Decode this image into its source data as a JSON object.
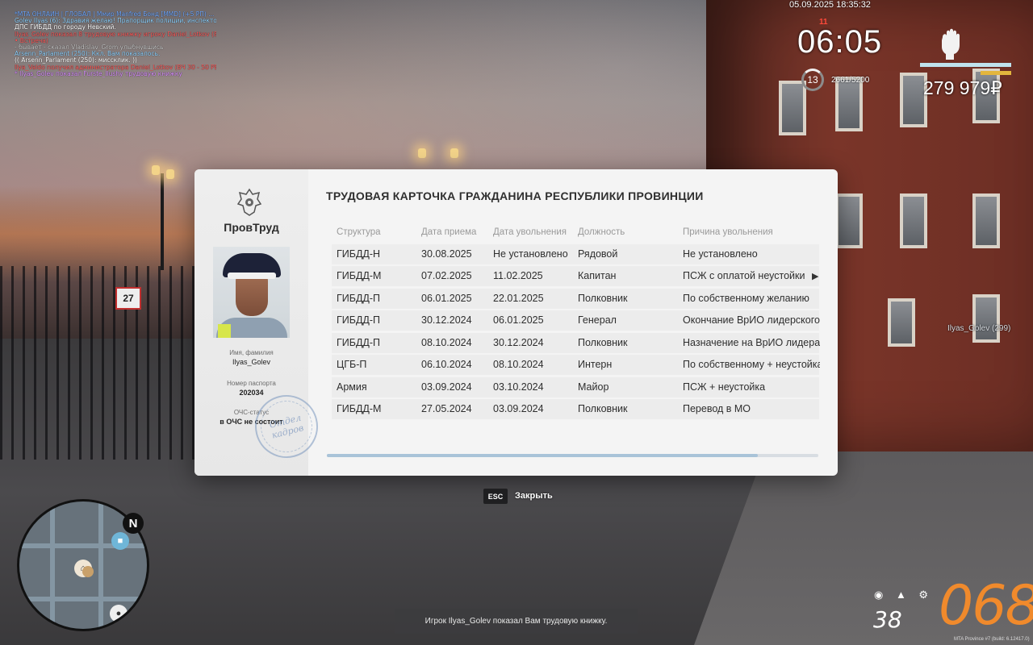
{
  "chat": [
    {
      "text": "*MTA ОНЛАЙН | ГЛОБАЛ | Ммир Manfred Бонд [MMD] (+5 РП) ...",
      "color": "#6fa8ff"
    },
    {
      "text": "Golev Ilyas (6): Здравия желаю! Прапорщик полиции, инспектор ОБ Ротарм,",
      "color": "#8fd3ff"
    },
    {
      "text": "ДПС ГИБДД по городу Невский.",
      "color": "#ffffff"
    },
    {
      "text": "Ilyas_Golev показал 8 трудовую книжку игроку Daniel_Lotkov (89 кмч.) (ВЛ)",
      "color": "#ff5a5a"
    },
    {
      "text": "• Встреча)",
      "color": "#ff5a5a"
    },
    {
      "text": "- бывает - сказал Vladislav_Grom улыбнувшись",
      "color": "#c9c9c9"
    },
    {
      "text": "Arsenn_Parlament (250): Ккл. Вам показалось.",
      "color": "#8fd3ff"
    },
    {
      "text": "(( Arsenn_Parlament (250): миссклик. ))",
      "color": "#ffffff"
    },
    {
      "text": "Ilya_Valdo получил администратора Daniel_Lotkov (ВЧ 30 - 50 РВ)",
      "color": "#ff5a5a"
    },
    {
      "text": "* Ilyas_Golev показал Furste_Ilushy трудовую книжку",
      "color": "#d98fff"
    }
  ],
  "hud": {
    "datetime": "05.09.2025 18:35:32",
    "ping": "11",
    "time": "06:05",
    "level": "13",
    "exp": "2661/5200",
    "money": "279 979₽",
    "health_fraction": 1.0,
    "armor_fraction": 0.34
  },
  "card": {
    "org_name": "ПровТруд",
    "title": "ТРУДОВАЯ КАРТОЧКА ГРАЖДАНИНА РЕСПУБЛИКИ ПРОВИНЦИИ",
    "name_label": "Имя, фамилия",
    "name_value": "Ilyas_Golev",
    "passport_label": "Номер паспорта",
    "passport_value": "202034",
    "status_label": "ОЧС-статус",
    "status_value": "в ОЧС не состоит",
    "stamp_line1": "Отдел",
    "stamp_line2": "кадров",
    "columns": [
      "Структура",
      "Дата приема",
      "Дата увольнения",
      "Должность",
      "Причина увольнения"
    ],
    "rows": [
      [
        "ГИБДД-Н",
        "30.08.2025",
        "Не установлено",
        "Рядовой",
        "Не установлено"
      ],
      [
        "ГИБДД-М",
        "07.02.2025",
        "11.02.2025",
        "Капитан",
        "ПСЖ с оплатой неустойки"
      ],
      [
        "ГИБДД-П",
        "06.01.2025",
        "22.01.2025",
        "Полковник",
        "По собственному желанию"
      ],
      [
        "ГИБДД-П",
        "30.12.2024",
        "06.01.2025",
        "Генерал",
        "Окончание ВрИО лидерского"
      ],
      [
        "ГИБДД-П",
        "08.10.2024",
        "30.12.2024",
        "Полковник",
        "Назначение на ВрИО лидера"
      ],
      [
        "ЦГБ-П",
        "06.10.2024",
        "08.10.2024",
        "Интерн",
        "По собственному + неустойка"
      ],
      [
        "Армия",
        "03.09.2024",
        "03.10.2024",
        "Майор",
        "ПСЖ + неустойка"
      ],
      [
        "ГИБДД-М",
        "27.05.2024",
        "03.09.2024",
        "Полковник",
        "Перевод в МО"
      ]
    ]
  },
  "close": {
    "key": "ESC",
    "label": "Закрыть"
  },
  "nametag": "Ilyas_Golev (299)",
  "minimap": {
    "north": "N"
  },
  "notification": "Игрок Ilyas_Golev показал Вам трудовую книжку.",
  "vehicle": {
    "speed": "068",
    "fuel": "38"
  },
  "build": "MTA Province #7 (build: 6.12417.0)",
  "colors": {
    "accent_speed": "#f08a2c",
    "hp_bar": "#bfe3ee",
    "armor_bar": "#e3b63d",
    "scroll_thumb": "#a9c3d8"
  }
}
